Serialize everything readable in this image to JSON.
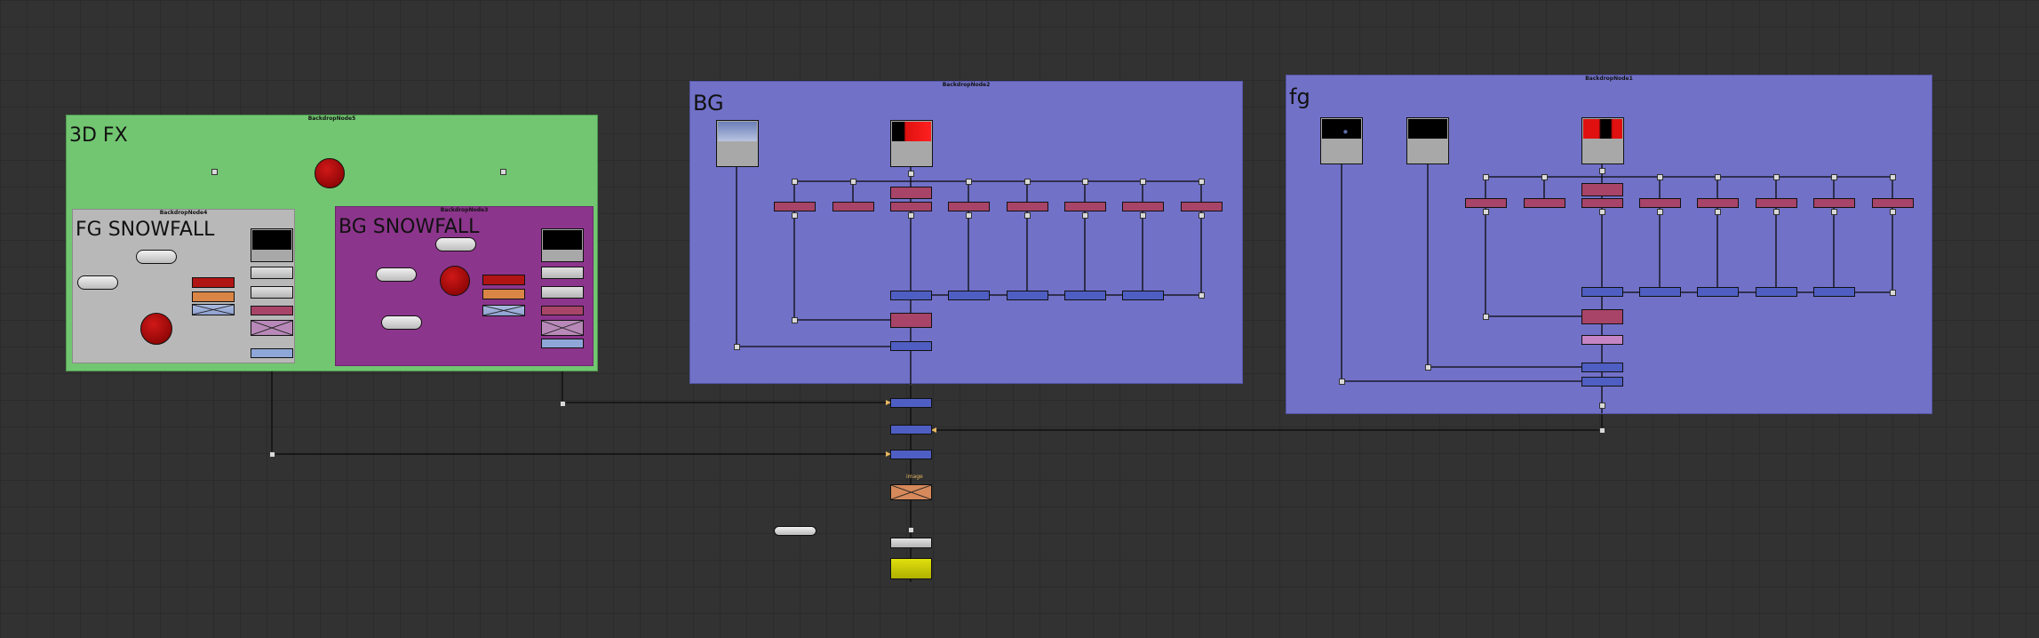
{
  "backdrops": {
    "fx3d": {
      "header": "BackdropNode5",
      "label": "3D FX"
    },
    "fg_snowfall": {
      "header": "BackdropNode4",
      "label": "FG SNOWFALL"
    },
    "bg_snowfall": {
      "header": "BackdropNode3",
      "label": "BG SNOWFALL"
    },
    "bg": {
      "header": "BackdropNode2",
      "label": "BG"
    },
    "fg": {
      "header": "BackdropNode1",
      "label": "fg"
    }
  },
  "colors": {
    "canvas": "#323232",
    "fx3d_backdrop": "#72c671",
    "fg_snowfall_backdrop": "#b8b8b8",
    "bg_snowfall_backdrop": "#8c358c",
    "bg_backdrop": "#7171c8",
    "fg_backdrop": "#7171c8",
    "merge_node": "#4e5ec2",
    "grade_node": "#a84468",
    "viewer_node": "#cccc00"
  },
  "labels": {
    "image_pin": "image"
  },
  "icons": {
    "read_node": "image-thumbnail-icon",
    "sphere_node": "sphere-icon",
    "card_node": "x-card-icon"
  }
}
